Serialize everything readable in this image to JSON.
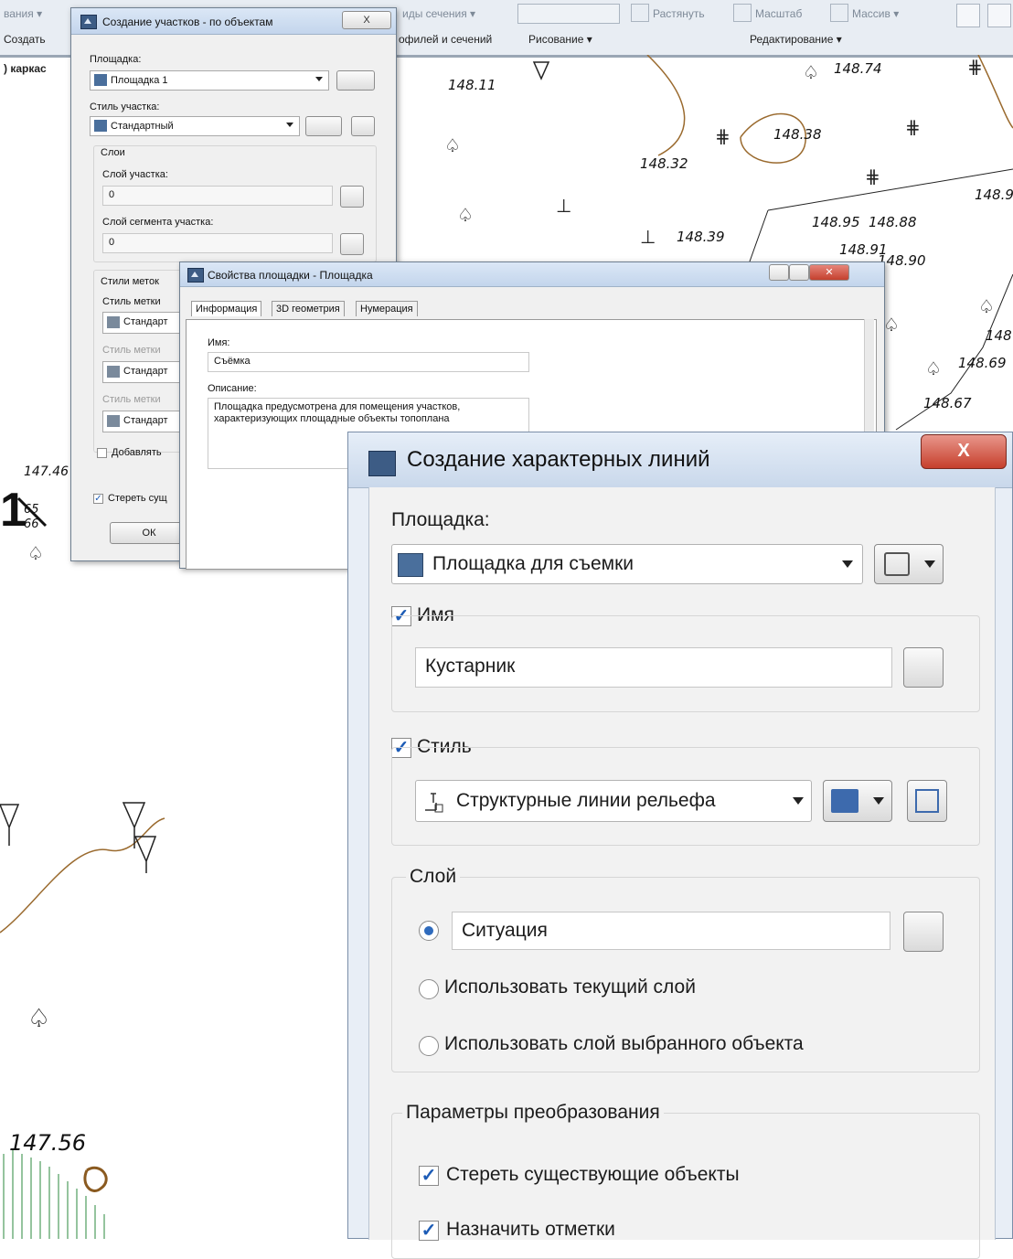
{
  "ribbon": {
    "left_top": "вания ▾",
    "create_label": "Создать",
    "section_views": "иды сечения ▾",
    "stretch": "Растянуть",
    "scale": "Масштаб",
    "array": "Массив ▾",
    "profiles_sections": "офилей и сечений",
    "drawing": "Рисование ▾",
    "editing": "Редактирование ▾"
  },
  "side_label": ") каркас",
  "map": {
    "elevations": [
      "148.11",
      "148.74",
      "148.38",
      "148.32",
      "148.39",
      "148.95",
      "148.88",
      "148.91",
      "148.90",
      "148.9",
      "148.69",
      "148.67",
      "148",
      "147.46",
      "65",
      "66",
      "147.56"
    ],
    "big_label": "1"
  },
  "dialog_parcels": {
    "title": "Создание участков - по объектам",
    "close": "X",
    "site_label": "Площадка:",
    "site_value": "Площадка 1",
    "style_label": "Стиль участка:",
    "style_value": "Стандартный",
    "layers_group": "Слои",
    "parcel_layer_label": "Слой участка:",
    "parcel_layer_value": "0",
    "segment_layer_label": "Слой сегмента участка:",
    "segment_layer_value": "0",
    "label_styles_group": "Стили меток",
    "label_style_1": "Стиль метки",
    "label_value_1": "Стандарт",
    "label_style_2": "Стиль метки",
    "label_value_2": "Стандарт",
    "label_style_3": "Стиль метки",
    "label_value_3": "Стандарт",
    "add_label": "Добавлять",
    "erase_label": "Стереть сущ",
    "ok": "ОК"
  },
  "dialog_site_props": {
    "title": "Свойства площадки - Площадка",
    "tabs": [
      "Информация",
      "3D геометрия",
      "Нумерация"
    ],
    "name_label": "Имя:",
    "name_value": "Съёмка",
    "desc_label": "Описание:",
    "desc_value": "Площадка предусмотрена для помещения участков, характеризующих площадные объекты топоплана"
  },
  "dialog_feature_lines": {
    "title": "Создание характерных линий",
    "close": "X",
    "site_label": "Площадка:",
    "site_value": "Площадка для съемки",
    "name_check_label": "Имя",
    "name_value": "Кустарник",
    "style_check_label": "Стиль",
    "style_value": "Структурные линии рельефа",
    "layer_group": "Слой",
    "layer_value": "Ситуация",
    "radio_current": "Использовать текущий слой",
    "radio_selected": "Использовать слой выбранного объекта",
    "conversion_group": "Параметры преобразования",
    "erase_existing": "Стереть существующие объекты",
    "assign_elev": "Назначить отметки"
  }
}
